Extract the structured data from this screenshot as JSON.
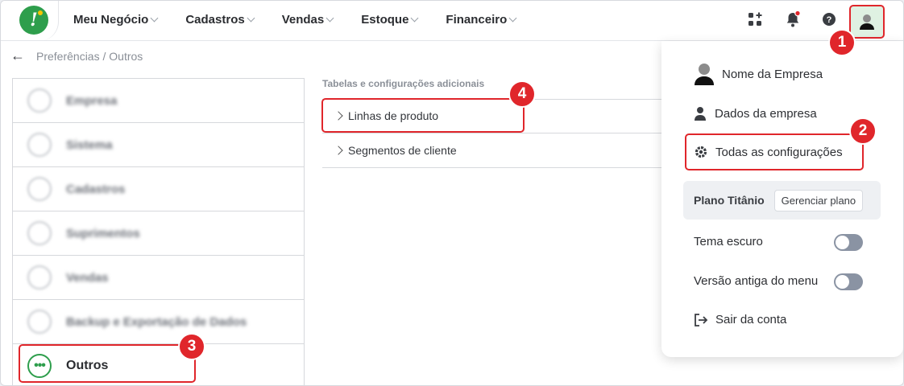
{
  "nav": {
    "items": [
      {
        "label": "Meu Negócio"
      },
      {
        "label": "Cadastros"
      },
      {
        "label": "Vendas"
      },
      {
        "label": "Estoque"
      },
      {
        "label": "Financeiro"
      }
    ],
    "icons": [
      "apps-icon",
      "bell-icon",
      "help-icon",
      "user-avatar-icon"
    ],
    "notification_color": "#e0262b"
  },
  "breadcrumb": {
    "text": "Preferências / Outros"
  },
  "sidebar": {
    "items": [
      {
        "label": "Empresa"
      },
      {
        "label": "Sistema"
      },
      {
        "label": "Cadastros"
      },
      {
        "label": "Suprimentos"
      },
      {
        "label": "Vendas"
      },
      {
        "label": "Backup e Exportação de Dados"
      },
      {
        "label": "Outros",
        "active": true
      }
    ]
  },
  "main": {
    "section_title": "Tabelas e configurações adicionais",
    "rows": [
      {
        "label": "Linhas de produto"
      },
      {
        "label": "Segmentos de cliente"
      }
    ]
  },
  "menu": {
    "company_name": "Nome da Empresa",
    "company_data": "Dados da empresa",
    "all_settings": "Todas as configurações",
    "plan_name": "Plano Titânio",
    "manage_plan": "Gerenciar plano",
    "dark_theme": "Tema escuro",
    "dark_theme_on": false,
    "old_menu": "Versão antiga do menu",
    "old_menu_on": false,
    "logout": "Sair da conta"
  },
  "annotations": {
    "badges": [
      "1",
      "2",
      "3",
      "4"
    ],
    "highlight_color": "#e0262b"
  },
  "colors": {
    "brand": "#2e9e4c",
    "accent": "#e0262b"
  }
}
